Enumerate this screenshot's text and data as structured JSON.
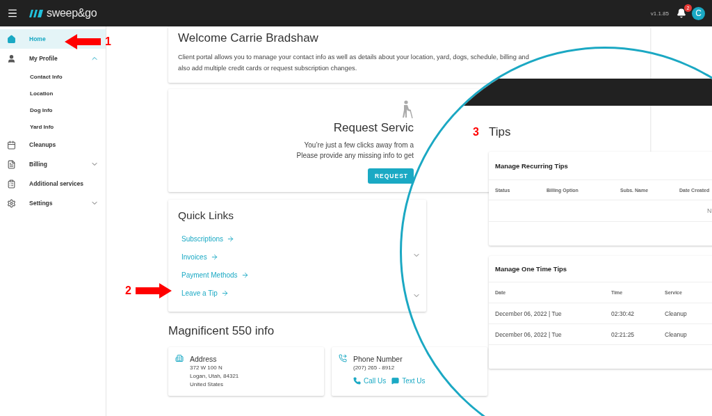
{
  "topbar": {
    "logo": "sweep&go",
    "version": "v1.1.85",
    "notifications": "2",
    "avatar": "C"
  },
  "sidebar": {
    "items": [
      {
        "label": "Home",
        "kind": "home",
        "selected": true
      },
      {
        "label": "My Profile",
        "kind": "profile",
        "selected": false,
        "expanded": true,
        "children": [
          {
            "label": "Contact Info",
            "selected": false
          },
          {
            "label": "Location",
            "selected": false
          },
          {
            "label": "Dog Info",
            "selected": false
          },
          {
            "label": "Yard Info",
            "selected": false
          }
        ]
      },
      {
        "label": "Cleanups",
        "kind": "calendar",
        "selected": false
      },
      {
        "label": "Billing",
        "kind": "billing",
        "selected": false,
        "expanded": false
      },
      {
        "label": "Additional services",
        "kind": "services",
        "selected": false
      },
      {
        "label": "Settings",
        "kind": "settings",
        "selected": false,
        "expanded": false
      }
    ]
  },
  "welcome": {
    "title": "Welcome Carrie Bradshaw",
    "lines": [
      "Client portal allows you to manage your contact info as well as details about your location, yard, dogs, schedule, billing and",
      "also add multiple credit cards or request subscription changes."
    ]
  },
  "request": {
    "title": "Request Servic",
    "lines": [
      "You’re just a few clicks away from a",
      "Please provide any missing info to get"
    ],
    "button": "REQUEST"
  },
  "quick_links": {
    "title": "Quick Links",
    "links": [
      "Subscriptions",
      "Invoices",
      "Payment Methods",
      "Leave a Tip"
    ]
  },
  "location": {
    "title": "Magnificent 550 info",
    "address": {
      "label": "Address",
      "lines": [
        "372 W 100 N",
        "Logan, Utah, 84321",
        "United States"
      ]
    },
    "phone": {
      "label": "Phone Number",
      "number": "(207) 265 - 8912",
      "actions": [
        {
          "label": "Call Us",
          "kind": "call"
        },
        {
          "label": "Text Us",
          "kind": "text"
        }
      ]
    }
  },
  "magnifier": {
    "marker": "3",
    "title": "Tips",
    "recurring": {
      "title": "Manage Recurring Tips",
      "columns": [
        "Status",
        "Billing Option",
        "Subs. Name",
        "Date Created"
      ],
      "empty": "N"
    },
    "one_time": {
      "title": "Manage One Time Tips",
      "columns": [
        "Date",
        "Time",
        "Service"
      ],
      "rows": [
        [
          "December 06, 2022 | Tue",
          "02:30:42",
          "Cleanup"
        ],
        [
          "December 06, 2022 | Tue",
          "02:21:25",
          "Cleanup"
        ]
      ]
    }
  },
  "annotations": [
    {
      "label": "1",
      "kind": "left"
    },
    {
      "label": "2",
      "kind": "right"
    }
  ]
}
